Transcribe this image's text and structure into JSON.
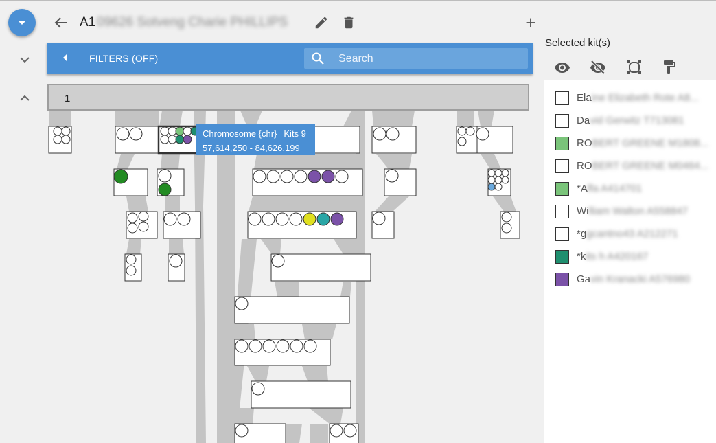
{
  "toolbar": {
    "title_prefix": "A1",
    "title_rest": "09626 Sotveng Charie PHILLIPS",
    "icons": [
      "menu-dropdown-icon",
      "back-arrow-icon",
      "edit-pencil-icon",
      "delete-trash-icon",
      "add-plus-icon",
      "collapse-chevron-down-icon",
      "expand-chevron-up-icon"
    ]
  },
  "filters": {
    "label": "FILTERS (OFF)",
    "search_placeholder": "Search",
    "search_value": ""
  },
  "chromosome_bar": {
    "label": "1"
  },
  "tooltip": {
    "title": "Chromosome {chr}",
    "kits": "Kits 9",
    "range": "57,614,250 - 84,626,199"
  },
  "selected_kits": {
    "label": "Selected kit(s)",
    "action_icons": [
      "show-eye-icon",
      "hide-eye-off-icon",
      "select-all-icon",
      "paint-format-icon"
    ],
    "items": [
      {
        "pre": "Ela",
        "rest": "ine Elizabeth Rote A8...",
        "color": "#ffffff"
      },
      {
        "pre": "Da",
        "rest": "vid Gerwitz T713081",
        "color": "#ffffff"
      },
      {
        "pre": "RO",
        "rest": "BERT GREENE M1808...",
        "color": "#7ac47a"
      },
      {
        "pre": "RO",
        "rest": "BERT GREENE M0464...",
        "color": "#ffffff"
      },
      {
        "pre": "*A",
        "rest": "lfa A414701",
        "color": "#7ac47a"
      },
      {
        "pre": "Wi",
        "rest": "lliam Walton A558847",
        "color": "#ffffff"
      },
      {
        "pre": "*g",
        "rest": "gcantno43 A212271",
        "color": "#ffffff"
      },
      {
        "pre": "*k",
        "rest": "its h A420167",
        "color": "#1f8f6f"
      },
      {
        "pre": "Ga",
        "rest": "vin Kranacki A576980",
        "color": "#7b52a8"
      }
    ]
  },
  "colors": {
    "accent": "#4a8fd4",
    "kit_light_green": "#7ac47a",
    "kit_dark_green": "#228b22",
    "kit_teal": "#1f8f6f",
    "kit_purple": "#7b52a8",
    "kit_yellow": "#e0e020",
    "kit_cyan": "#2aa6a6",
    "kit_light_blue": "#6aa8dc"
  }
}
